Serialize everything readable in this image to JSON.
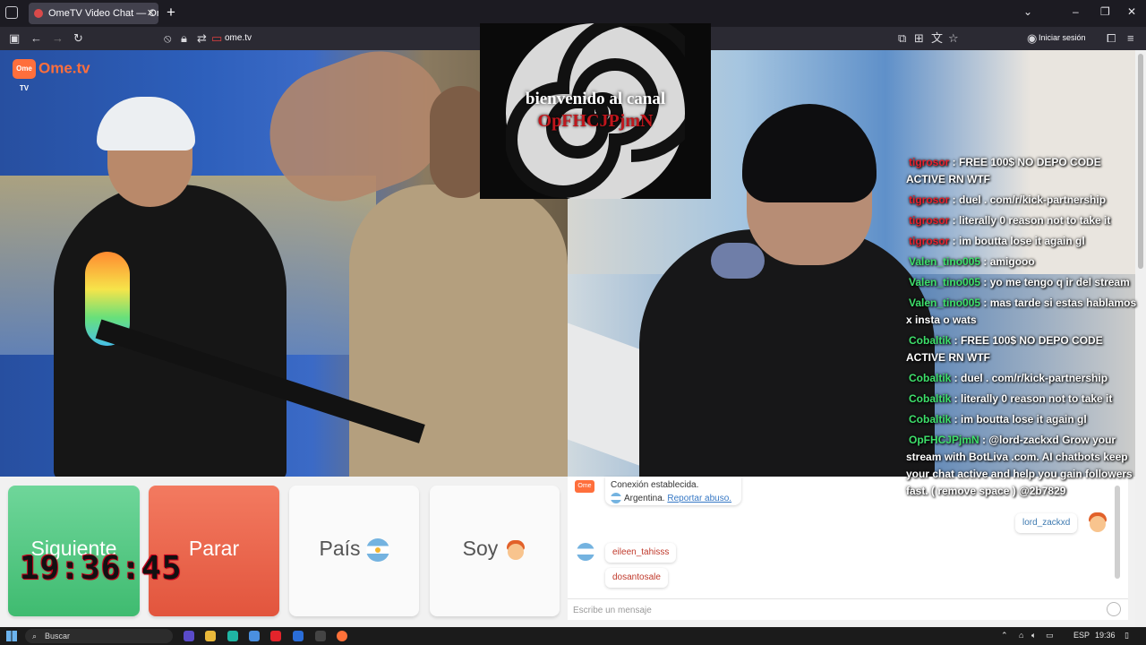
{
  "browser": {
    "tab_title": "OmeTV Video Chat — Ome",
    "url": "ome.tv",
    "signin_label": "Iniciar sesión"
  },
  "site": {
    "logo_text": "Ome.tv",
    "logo_box_text": "Ome TV"
  },
  "overlay": {
    "banner_line1": "bienvenido al canal",
    "banner_line2": "OpFHCJPjmN",
    "chat": [
      {
        "user": "tigrosor",
        "color": "#e8202b",
        "text": ": FREE 100$ NO DEPO CODE ACTIVE RN WTF"
      },
      {
        "user": "tigrosor",
        "color": "#e8202b",
        "text": ": duel . com/r/kick-partnership"
      },
      {
        "user": "tigrosor",
        "color": "#e8202b",
        "text": ": literally 0 reason not to take it"
      },
      {
        "user": "tigrosor",
        "color": "#e8202b",
        "text": ": im boutta lose it again gl"
      },
      {
        "user": "Valen_tino005",
        "color": "#3ee06b",
        "text": ": amigooo"
      },
      {
        "user": "Valen_tino005",
        "color": "#3ee06b",
        "text": ": yo me tengo q ir del stream"
      },
      {
        "user": "Valen_tino005",
        "color": "#3ee06b",
        "text": ": mas tarde si estas hablamos x insta o wats"
      },
      {
        "user": "Cobaltik",
        "color": "#3ee06b",
        "text": ": FREE 100$ NO DEPO CODE ACTIVE RN WTF"
      },
      {
        "user": "Cobaltik",
        "color": "#3ee06b",
        "text": ": duel . com/r/kick-partnership"
      },
      {
        "user": "Cobaltik",
        "color": "#3ee06b",
        "text": ": literally 0 reason not to take it"
      },
      {
        "user": "Cobaltik",
        "color": "#3ee06b",
        "text": ": im boutta lose it again gl"
      },
      {
        "user": "OpFHCJPjmN",
        "color": "#3ee06b",
        "text": ": @lord-zackxd Grow your stream with BotLiva .com. AI chatbots keep your chat active and help you gain followers fast. ( remove space ) @2b7829"
      }
    ],
    "clock": "19:36:45"
  },
  "controls": {
    "next_label": "Siguiente",
    "stop_label": "Parar",
    "country_label": "País",
    "me_label": "Soy"
  },
  "chat_panel": {
    "system_status": "Conexión establecida.",
    "system_country": "Argentina.",
    "report_link": "Reportar abuso.",
    "my_message": "lord_zackxd",
    "peer_messages": [
      "eileen_tahisss",
      "dosantosale"
    ],
    "input_placeholder": "Escribe un mensaje"
  },
  "taskbar": {
    "search_label": "Buscar",
    "language": "ESP",
    "time": "19:36"
  },
  "icons": {
    "tab_list": "tab-list-icon",
    "back": "back-arrow-icon",
    "forward": "forward-arrow-icon",
    "reload": "reload-icon",
    "lock": "lock-icon",
    "bookmark": "star-icon"
  }
}
